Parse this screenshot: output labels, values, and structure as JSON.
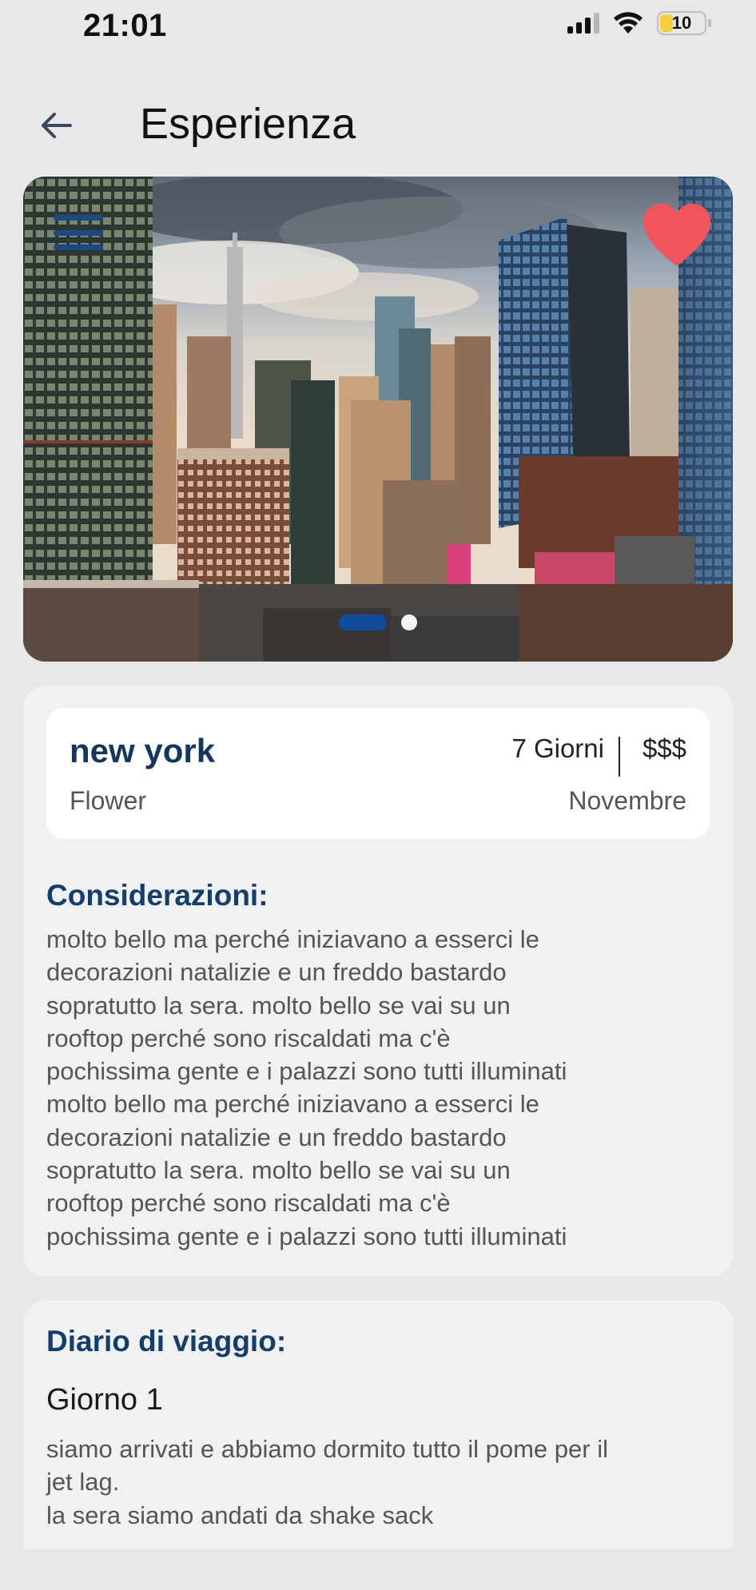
{
  "status": {
    "time": "21:01",
    "battery": "10",
    "battery_color": "#f5cf3c"
  },
  "header": {
    "title": "Esperienza",
    "back_icon": "arrow-left-icon"
  },
  "hero": {
    "menu_icon": "hamburger-menu-icon",
    "favorite_icon": "heart-icon",
    "favorite_color": "#f2545b",
    "carousel_slides": 2,
    "carousel_active": 1
  },
  "trip": {
    "city": "new york",
    "subtitle": "Flower",
    "duration": "7 Giorni",
    "price": "$$$",
    "month": "Novembre"
  },
  "considerations": {
    "title": "Considerazioni:",
    "text": "molto bello ma perché iniziavano a esserci le\ndecorazioni natalizie e un freddo bastardo\nsopratutto la sera. molto bello se vai su un\nrooftop perché sono riscaldati ma c'è\npochissima gente e i palazzi sono tutti illuminati\nmolto bello ma perché iniziavano a esserci le\ndecorazioni natalizie e un freddo bastardo\nsopratutto la sera. molto bello se vai su un\nrooftop perché sono riscaldati ma c'è\npochissima gente e i palazzi sono tutti illuminati"
  },
  "diary": {
    "title": "Diario di viaggio:",
    "days": [
      {
        "label": "Giorno 1",
        "text": "siamo arrivati e abbiamo dormito tutto il pome per il\njet lag.\nla sera siamo andati da shake sack"
      }
    ]
  },
  "colors": {
    "accent": "#123e6c",
    "carousel_active": "#0d4d9a",
    "background": "#e8e8e8",
    "panel": "#f1f1f1"
  }
}
